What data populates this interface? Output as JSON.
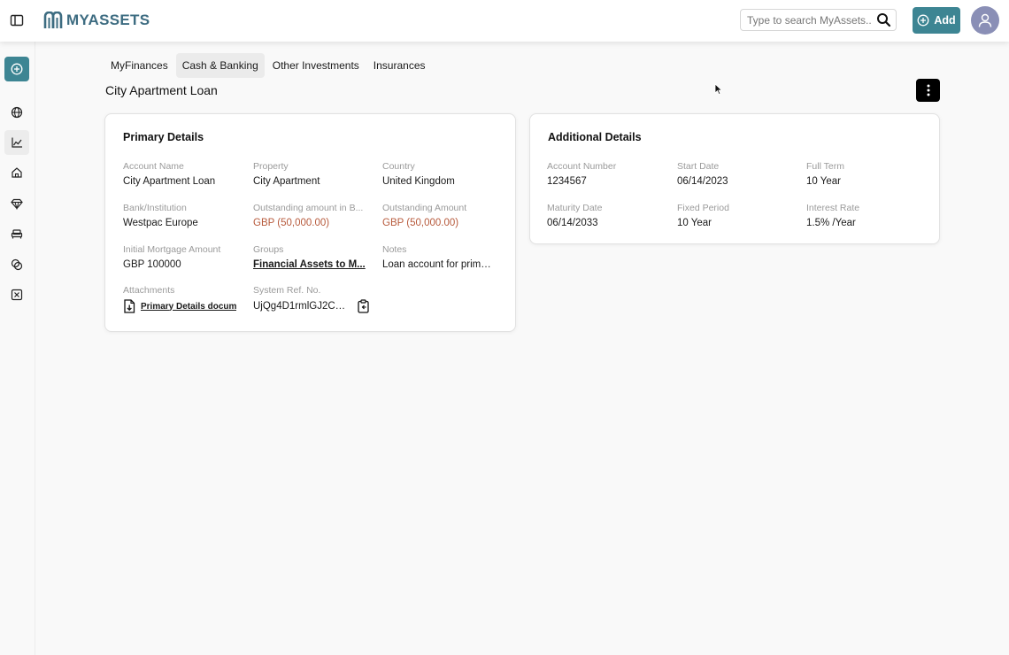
{
  "brand": {
    "name": "MYASSETS",
    "accent": "#3d8593",
    "logo_color": "#3d6c81"
  },
  "header": {
    "search_placeholder": "Type to search MyAssets...",
    "add_label": "Add"
  },
  "tabs": [
    {
      "label": "MyFinances",
      "active": false
    },
    {
      "label": "Cash & Banking",
      "active": true
    },
    {
      "label": "Other Investments",
      "active": false
    },
    {
      "label": "Insurances",
      "active": false
    }
  ],
  "page": {
    "title": "City Apartment Loan"
  },
  "primary": {
    "title": "Primary Details",
    "account_name": {
      "label": "Account Name",
      "value": "City Apartment Loan"
    },
    "property": {
      "label": "Property",
      "value": "City Apartment"
    },
    "country": {
      "label": "Country",
      "value": "United Kingdom"
    },
    "bank": {
      "label": "Bank/Institution",
      "value": "Westpac Europe"
    },
    "outstanding_base": {
      "label": "Outstanding amount in B...",
      "value": "GBP (50,000.00)"
    },
    "outstanding": {
      "label": "Outstanding Amount",
      "value": "GBP (50,000.00)"
    },
    "initial_mortgage": {
      "label": "Initial Mortgage Amount",
      "value": "GBP 100000"
    },
    "groups": {
      "label": "Groups",
      "value": "Financial Assets to M..."
    },
    "notes": {
      "label": "Notes",
      "value": "Loan account for primar..."
    },
    "attachments": {
      "label": "Attachments",
      "value": "Primary Details docum"
    },
    "system_ref": {
      "label": "System Ref. No.",
      "value": "UjQg4D1rmlGJ2CK..."
    }
  },
  "additional": {
    "title": "Additional Details",
    "account_number": {
      "label": "Account Number",
      "value": "1234567"
    },
    "start_date": {
      "label": "Start Date",
      "value": "06/14/2023"
    },
    "full_term": {
      "label": "Full Term",
      "value": "10 Year"
    },
    "maturity_date": {
      "label": "Maturity Date",
      "value": "06/14/2033"
    },
    "fixed_period": {
      "label": "Fixed Period",
      "value": "10 Year"
    },
    "interest_rate": {
      "label": "Interest Rate",
      "value": "1.5% /Year"
    }
  },
  "sidenav": {
    "items": [
      "globe-icon",
      "chart-icon",
      "home-icon",
      "diamond-icon",
      "sofa-icon",
      "coins-icon",
      "close-box-icon"
    ],
    "active": "chart-icon"
  }
}
